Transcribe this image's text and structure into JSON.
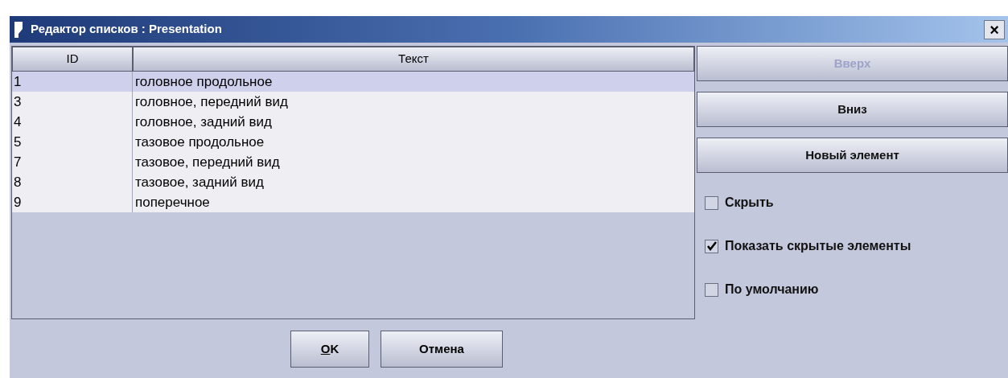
{
  "window": {
    "title": "Редактор списков : Presentation",
    "close": "×"
  },
  "table": {
    "columns": [
      "ID",
      "Текст"
    ],
    "rows": [
      {
        "id": "1",
        "text": "головное продольное",
        "selected": true
      },
      {
        "id": "3",
        "text": "головное, передний вид",
        "selected": false
      },
      {
        "id": "4",
        "text": "головное, задний вид",
        "selected": false
      },
      {
        "id": "5",
        "text": "тазовое продольное",
        "selected": false
      },
      {
        "id": "7",
        "text": "тазовое, передний вид",
        "selected": false
      },
      {
        "id": "8",
        "text": "тазовое, задний вид",
        "selected": false
      },
      {
        "id": "9",
        "text": "поперечное",
        "selected": false
      }
    ]
  },
  "side_buttons": [
    {
      "label": "Вверх",
      "disabled": true
    },
    {
      "label": "Вниз",
      "disabled": false
    },
    {
      "label": "Новый элемент",
      "disabled": false
    }
  ],
  "checkboxes": [
    {
      "label": "Скрыть",
      "checked": false
    },
    {
      "label": "Показать скрытые элементы",
      "checked": true
    },
    {
      "label": "По умолчанию",
      "checked": false
    }
  ],
  "buttons": [
    {
      "label": "OK"
    },
    {
      "label": "Отмена"
    }
  ]
}
